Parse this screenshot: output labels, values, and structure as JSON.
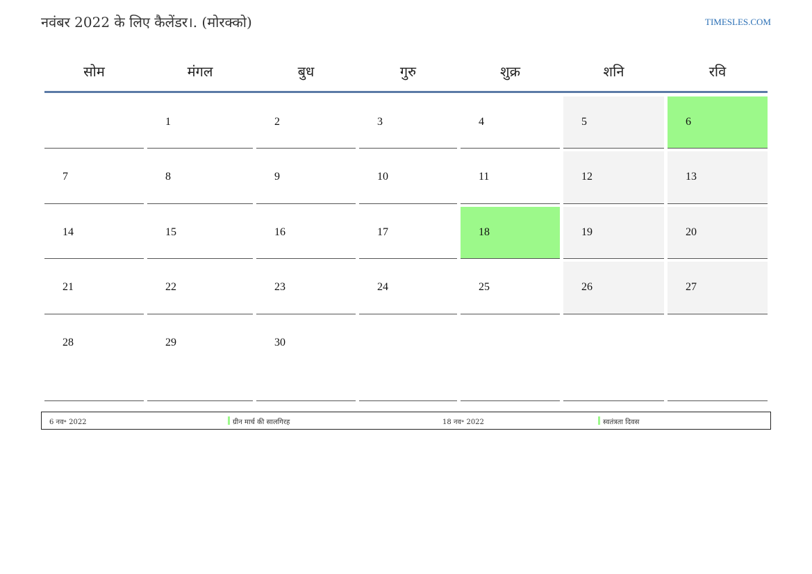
{
  "header": {
    "title": "नवंबर 2022 के लिए कैलेंडर।. (मोरक्को)",
    "site": "TIMESLES.COM"
  },
  "weekdays": [
    "सोम",
    "मंगल",
    "बुध",
    "गुरु",
    "शुक्र",
    "शनि",
    "रवि"
  ],
  "weeks": [
    [
      "",
      "1",
      "2",
      "3",
      "4",
      "5",
      "6"
    ],
    [
      "7",
      "8",
      "9",
      "10",
      "11",
      "12",
      "13"
    ],
    [
      "14",
      "15",
      "16",
      "17",
      "18",
      "19",
      "20"
    ],
    [
      "21",
      "22",
      "23",
      "24",
      "25",
      "26",
      "27"
    ],
    [
      "28",
      "29",
      "30",
      "",
      "",
      "",
      ""
    ]
  ],
  "holidays": [
    "6",
    "18"
  ],
  "colors": {
    "holiday": "#9cf98a",
    "weekend": "#f3f3f3",
    "header_rule": "#5b7aa6",
    "link": "#2a6fb5"
  },
  "legend": [
    {
      "date": "6 नव॰ 2022",
      "name": "ग्रीन मार्च की सालगिरह"
    },
    {
      "date": "18 नव॰ 2022",
      "name": "स्वतंत्रता दिवस"
    }
  ]
}
